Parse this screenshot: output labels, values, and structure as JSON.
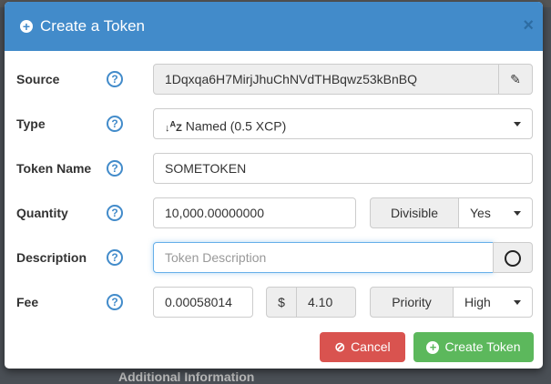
{
  "modal": {
    "title": "Create a Token",
    "close": "×"
  },
  "background": {
    "text": "Additional Information"
  },
  "fields": {
    "source": {
      "label": "Source",
      "value": "1Dqxqa6H7MirjJhuChNVdTHBqwz53kBnBQ"
    },
    "type": {
      "label": "Type",
      "value": "Named (0.5 XCP)"
    },
    "token_name": {
      "label": "Token Name",
      "value": "SOMETOKEN"
    },
    "quantity": {
      "label": "Quantity",
      "value": "10,000.00000000",
      "divisible_label": "Divisible",
      "divisible_value": "Yes"
    },
    "description": {
      "label": "Description",
      "placeholder": "Token Description"
    },
    "fee": {
      "label": "Fee",
      "value": "0.00058014",
      "currency": "$",
      "usd": "4.10",
      "priority_label": "Priority",
      "priority_value": "High"
    }
  },
  "help": "?",
  "buttons": {
    "cancel": "Cancel",
    "create": "Create Token"
  }
}
